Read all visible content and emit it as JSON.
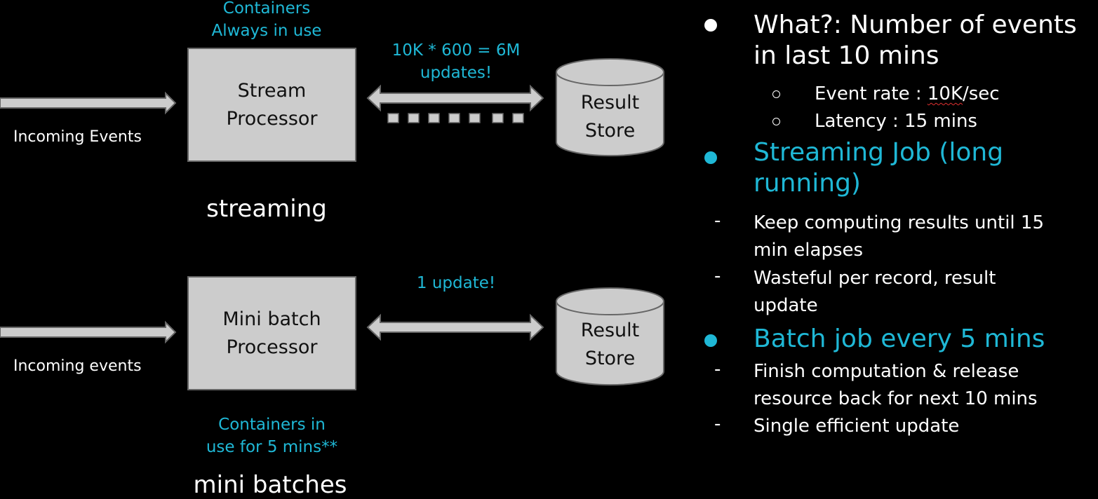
{
  "streaming_section": {
    "container_note": [
      "Containers",
      "Always in use"
    ],
    "processor_label": [
      "Stream",
      "Processor"
    ],
    "input_label": "Incoming Events",
    "update_note": [
      "10K * 600 = 6M",
      "updates!"
    ],
    "store_label": [
      "Result",
      "Store"
    ],
    "dashed_blocks": 7,
    "title": "streaming"
  },
  "batch_section": {
    "processor_label": [
      "Mini batch",
      "Processor"
    ],
    "input_label": "Incoming events",
    "update_note": "1 update!",
    "store_label": [
      "Result",
      "Store"
    ],
    "container_note": [
      "Containers in",
      "use for 5 mins**"
    ],
    "title": "mini batches"
  },
  "bullets": {
    "what": {
      "marker": "filled-dot",
      "lines": [
        "What?: Number of events",
        "in last 10 mins"
      ],
      "sub": [
        {
          "marker": "hollow-circle",
          "prefix": "Event rate : ",
          "flagged": "10K",
          "suffix": "/sec"
        },
        {
          "marker": "hollow-circle",
          "text": "Latency : 15 mins"
        }
      ]
    },
    "streaming_job": {
      "marker": "filled-dot",
      "lines": [
        "Streaming Job (long",
        "running)"
      ],
      "sub": [
        {
          "marker": "dash",
          "lines": [
            "Keep computing results until 15",
            "min elapses"
          ]
        },
        {
          "marker": "dash",
          "lines": [
            "Wasteful per record, result",
            "update"
          ]
        }
      ]
    },
    "batch_job": {
      "marker": "filled-dot",
      "lines": [
        "Batch job every 5 mins"
      ],
      "sub": [
        {
          "marker": "dash",
          "lines": [
            "Finish computation & release",
            "resource back for next 10 mins"
          ]
        },
        {
          "marker": "dash",
          "lines": [
            "Single efficient update"
          ]
        }
      ]
    },
    "dash_glyph": "-"
  },
  "colors": {
    "background": "#000000",
    "accent": "#1fb8d6",
    "shape_fill": "#cccccc",
    "shape_stroke": "#666666",
    "text": "#ffffff"
  }
}
